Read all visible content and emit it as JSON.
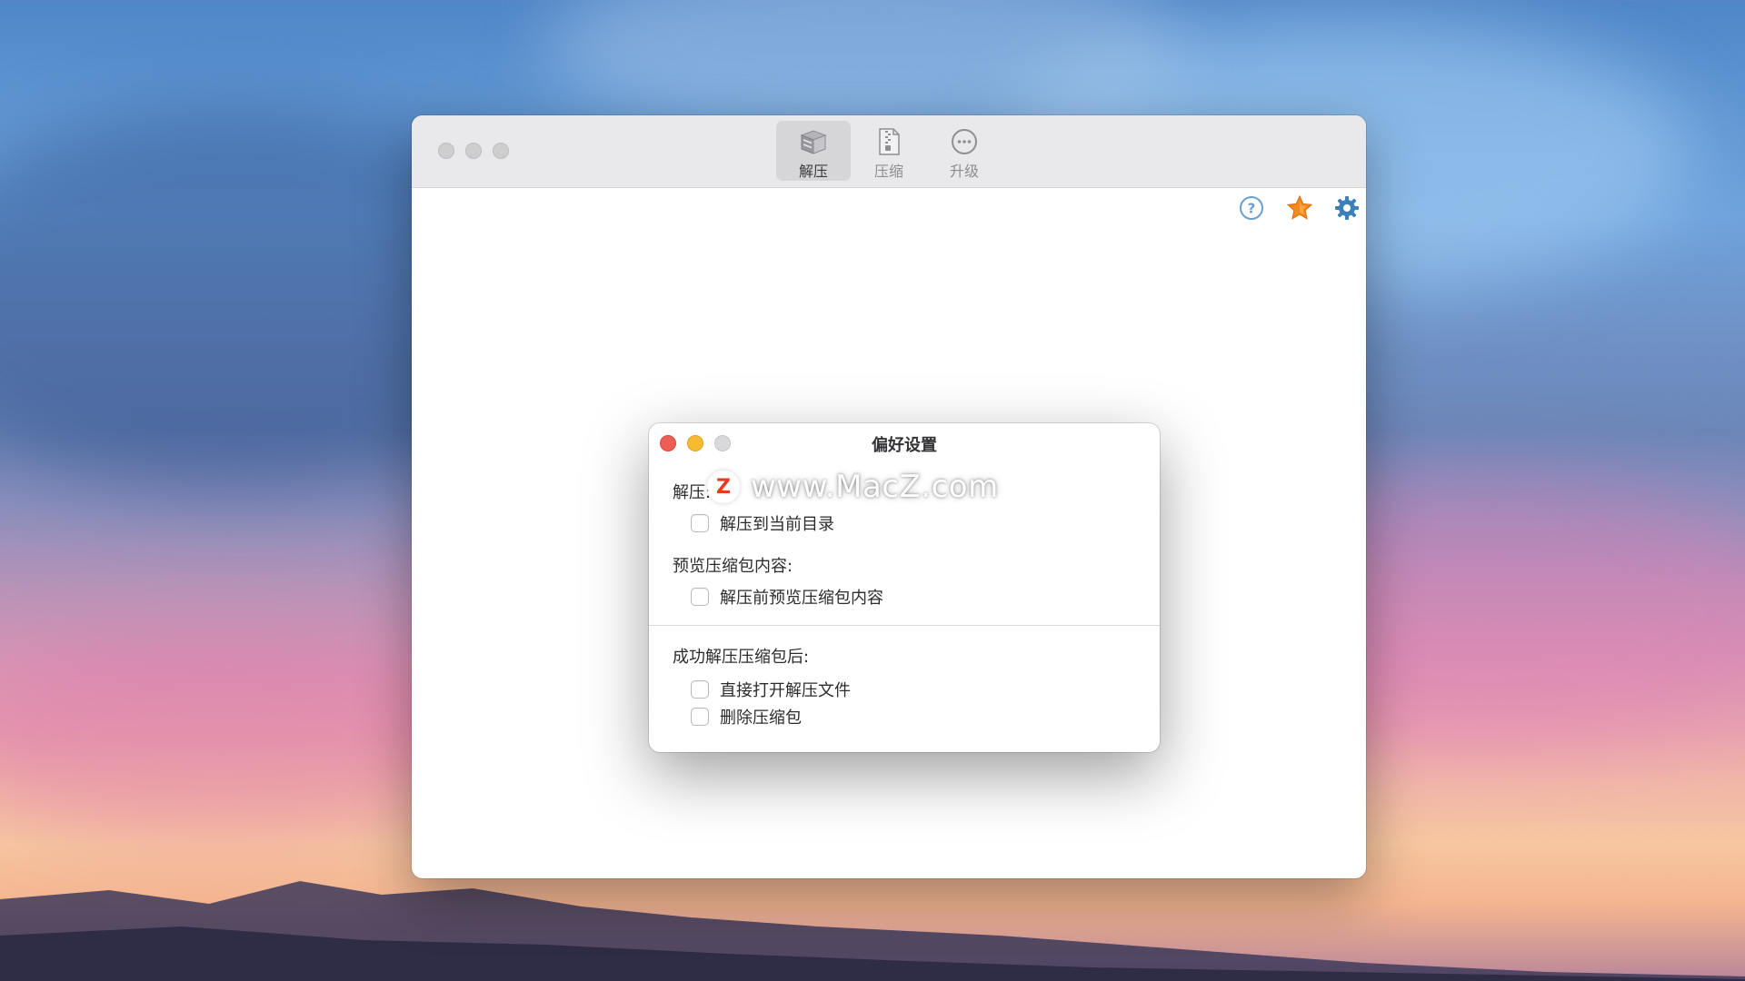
{
  "main_window": {
    "toolbar": {
      "tabs": [
        {
          "label": "解压",
          "icon": "archive-box-icon",
          "active": true
        },
        {
          "label": "压缩",
          "icon": "zipper-file-icon",
          "active": false
        },
        {
          "label": "升级",
          "icon": "ellipsis-circle-icon",
          "active": false
        }
      ]
    },
    "actions": [
      {
        "icon": "help-icon"
      },
      {
        "icon": "star-icon",
        "color": "#f08a1c"
      },
      {
        "icon": "gear-icon",
        "color": "#3f7fb8"
      }
    ]
  },
  "preferences": {
    "title": "偏好设置",
    "watermark": {
      "badge": "Z",
      "text": "www.MacZ.com"
    },
    "sections": {
      "extract": {
        "label": "解压:",
        "options": [
          {
            "label": "解压到当前目录",
            "checked": false
          }
        ]
      },
      "preview": {
        "label": "预览压缩包内容:",
        "options": [
          {
            "label": "解压前预览压缩包内容",
            "checked": false
          }
        ]
      },
      "after_success": {
        "label": "成功解压压缩包后:",
        "options": [
          {
            "label": "直接打开解压文件",
            "checked": false
          },
          {
            "label": "删除压缩包",
            "checked": false
          }
        ]
      }
    }
  }
}
